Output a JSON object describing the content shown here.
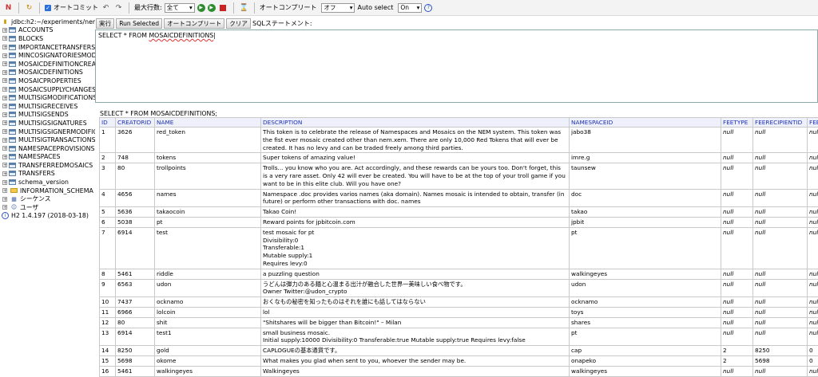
{
  "toolbar": {
    "autocommit_label": "オートコミット",
    "maxrows_label": "最大行数:",
    "maxrows_value": "全て",
    "autocomplete_label": "オートコンプリート",
    "autocomplete_value": "オフ",
    "autoselect_label": "Auto select",
    "autoselect_value": "On"
  },
  "sidebar": {
    "connection": "jdbc:h2:~/experiments/nem-expe",
    "tables": [
      "ACCOUNTS",
      "BLOCKS",
      "IMPORTANCETRANSFERS",
      "MINCOSIGNATORIESMODIF",
      "MOSAICDEFINITIONCREAT",
      "MOSAICDEFINITIONS",
      "MOSAICPROPERTIES",
      "MOSAICSUPPLYCHANGES",
      "MULTISIGMODIFICATIONS",
      "MULTISIGRECEIVES",
      "MULTISIGSENDS",
      "MULTISIGSIGNATURES",
      "MULTISIGSIGNERMODIFICA",
      "MULTISIGTRANSACTIONS",
      "NAMESPACEPROVISIONS",
      "NAMESPACES",
      "TRANSFERREDMOSAICS",
      "TRANSFERS",
      "schema_version"
    ],
    "schema": "INFORMATION_SCHEMA",
    "sequences": "シーケンス",
    "users": "ユーザ",
    "version": "H2 1.4.197 (2018-03-18)"
  },
  "buttons": {
    "run": "実行",
    "run_selected": "Run Selected",
    "autocomplete": "オートコンプリート",
    "clear": "クリア",
    "statement_label": "SQLステートメント:"
  },
  "editor": {
    "prefix": "SELECT * FROM ",
    "table": "MOSAICDEFINITIONS"
  },
  "result": {
    "query": "SELECT * FROM MOSAICDEFINITIONS;",
    "columns": [
      "ID",
      "CREATORID",
      "NAME",
      "DESCRIPTION",
      "NAMESPACEID",
      "FEETYPE",
      "FEERECIPIENTID",
      "FEE"
    ],
    "rows": [
      [
        "1",
        "3626",
        "red_token",
        "This token is to celebrate the release of Namespaces and Mosaics on the NEM system. This token was the fist ever mosaic created other than nem.xem. There are only 10,000 Red Tokens that will ever be created. It has no levy and can be traded freely among third parties.",
        "jabo38",
        "null",
        "null",
        "null"
      ],
      [
        "2",
        "748",
        "tokens",
        "Super tokens of amazing value!",
        "imre.g",
        "null",
        "null",
        "null"
      ],
      [
        "3",
        "80",
        "trollpoints",
        "Trolls... you know who you are. Act accordingly, and these rewards can be yours too. Don't forget, this is a very rare asset. Only 42 will ever be created. You will have to be at the top of your troll game if you want to be in this elite club. Will you have one?",
        "taunsew",
        "null",
        "null",
        "null"
      ],
      [
        "4",
        "4656",
        "names",
        "Namespace .doc provides varios names (aka domain). Names mosaic is intended to obtain, transfer (in future) or perform other transactions with doc. names",
        "doc",
        "null",
        "null",
        "null"
      ],
      [
        "5",
        "5636",
        "takaocoin",
        "Takao Coin!",
        "takao",
        "null",
        "null",
        "null"
      ],
      [
        "6",
        "5038",
        "pt",
        "Reward points for jpbitcoin.com",
        "jpbit",
        "null",
        "null",
        "null"
      ],
      [
        "7",
        "6914",
        "test",
        "test mosaic for pt\nDivisibility:0\nTransferable:1\nMutable supply:1\nRequires levy:0",
        "pt",
        "null",
        "null",
        "null"
      ],
      [
        "8",
        "5461",
        "riddle",
        "a puzzling question",
        "walkingeyes",
        "null",
        "null",
        "null"
      ],
      [
        "9",
        "6563",
        "udon",
        "うどんは弾力のある麺と心温まる出汁が融合した世界一美味しい食べ物です。\nOwner Twitter:@udon_crypto",
        "udon",
        "null",
        "null",
        "null"
      ],
      [
        "10",
        "7437",
        "ocknamo",
        "おくなもの秘密を知ったものはそれを誰にも話してはならない",
        "ocknamo",
        "null",
        "null",
        "null"
      ],
      [
        "11",
        "6966",
        "lolcoin",
        "lol",
        "toys",
        "null",
        "null",
        "null"
      ],
      [
        "12",
        "80",
        "shit",
        "\"Shitshares will be bigger than Bitcoin!\" – Milan",
        "shares",
        "null",
        "null",
        "null"
      ],
      [
        "13",
        "6914",
        "test1",
        "small business mosaic.\nInitial supply:10000 Divisibility:0 Transferable:true Mutable supply:true Requires levy:false",
        "pt",
        "null",
        "null",
        "null"
      ],
      [
        "14",
        "8250",
        "gold",
        "CAPLOGUEの基本通貨です。",
        "cap",
        "2",
        "8250",
        "0"
      ],
      [
        "15",
        "5698",
        "okome",
        "What makes you glad when sent to you, whoever the sender may be.",
        "onapeko",
        "2",
        "5698",
        "0"
      ],
      [
        "16",
        "5461",
        "walkingeyes",
        "Walkingeyes",
        "walkingeyes",
        "null",
        "null",
        "null"
      ]
    ]
  }
}
